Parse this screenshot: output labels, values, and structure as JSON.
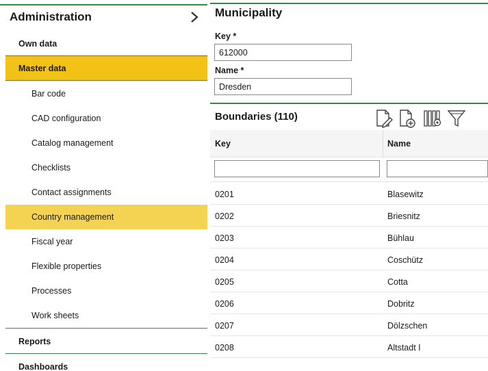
{
  "sidebar": {
    "title": "Administration",
    "items_top": [
      {
        "label": "Own data"
      },
      {
        "label": "Master data"
      }
    ],
    "sub_items": [
      {
        "label": "Bar code"
      },
      {
        "label": "CAD configuration"
      },
      {
        "label": "Catalog management"
      },
      {
        "label": "Checklists"
      },
      {
        "label": "Contact assignments"
      },
      {
        "label": "Country management"
      },
      {
        "label": "Fiscal year"
      },
      {
        "label": "Flexible properties"
      },
      {
        "label": "Processes"
      },
      {
        "label": "Work sheets"
      }
    ],
    "items_bottom": [
      {
        "label": "Reports"
      },
      {
        "label": "Dashboards"
      }
    ]
  },
  "municipality": {
    "title": "Municipality",
    "key_label": "Key *",
    "key_value": "612000",
    "name_label": "Name *",
    "name_value": "Dresden"
  },
  "boundaries": {
    "title": "Boundaries (110)",
    "col_key": "Key",
    "col_name": "Name",
    "rows": [
      {
        "key": "0201",
        "name": "Blasewitz"
      },
      {
        "key": "0202",
        "name": "Briesnitz"
      },
      {
        "key": "0203",
        "name": "Bühlau"
      },
      {
        "key": "0204",
        "name": "Coschütz"
      },
      {
        "key": "0205",
        "name": "Cotta"
      },
      {
        "key": "0206",
        "name": "Dobritz"
      },
      {
        "key": "0207",
        "name": "Dölzschen"
      },
      {
        "key": "0208",
        "name": "Altstadt I"
      }
    ]
  },
  "toolbar": {
    "icons": [
      "edit-document-icon",
      "add-document-icon",
      "column-settings-icon",
      "filter-icon"
    ]
  },
  "colors": {
    "accent_green": "#2e8b4e",
    "active_yellow": "#f2c217",
    "selected_yellow": "#f5d352"
  }
}
